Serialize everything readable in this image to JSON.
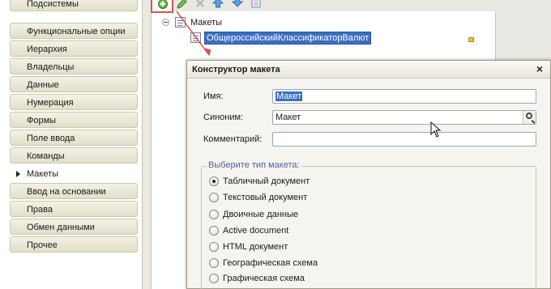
{
  "nav": {
    "items": [
      {
        "label": "Подсистемы"
      },
      {
        "label": "Функциональные опции"
      },
      {
        "label": "Иерархия"
      },
      {
        "label": "Владельцы"
      },
      {
        "label": "Данные"
      },
      {
        "label": "Нумерация"
      },
      {
        "label": "Формы"
      },
      {
        "label": "Поле ввода"
      },
      {
        "label": "Команды"
      },
      {
        "label": "Макеты"
      },
      {
        "label": "Ввод на основании"
      },
      {
        "label": "Права"
      },
      {
        "label": "Обмен данными"
      },
      {
        "label": "Прочее"
      }
    ],
    "active_label": "Макеты"
  },
  "toolbar": {
    "icons": [
      "add-icon",
      "edit-icon",
      "delete-icon",
      "move-up-icon",
      "move-down-icon",
      "sort-icon"
    ]
  },
  "tree": {
    "root_label": "Макеты",
    "child_label": "ОбщероссийскийКлассификаторВалют"
  },
  "dialog": {
    "title": "Конструктор макета",
    "close_glyph": "×",
    "name_label": "Имя:",
    "name_value": "Макет",
    "synonym_label": "Синоним:",
    "synonym_value": "Макет",
    "comment_label": "Комментарий:",
    "comment_value": "",
    "type_group_title": "Выберите тип макета:",
    "type_options": [
      {
        "label": "Табличный документ",
        "selected": true
      },
      {
        "label": "Текстовый документ",
        "selected": false
      },
      {
        "label": "Двоичные данные",
        "selected": false
      },
      {
        "label": "Active document",
        "selected": false
      },
      {
        "label": "HTML документ",
        "selected": false
      },
      {
        "label": "Географическая схема",
        "selected": false
      },
      {
        "label": "Графическая схема",
        "selected": false
      }
    ]
  },
  "colors": {
    "annotation": "#d9534f",
    "selection": "#3a6fc2",
    "group_title": "#4d63a0"
  }
}
